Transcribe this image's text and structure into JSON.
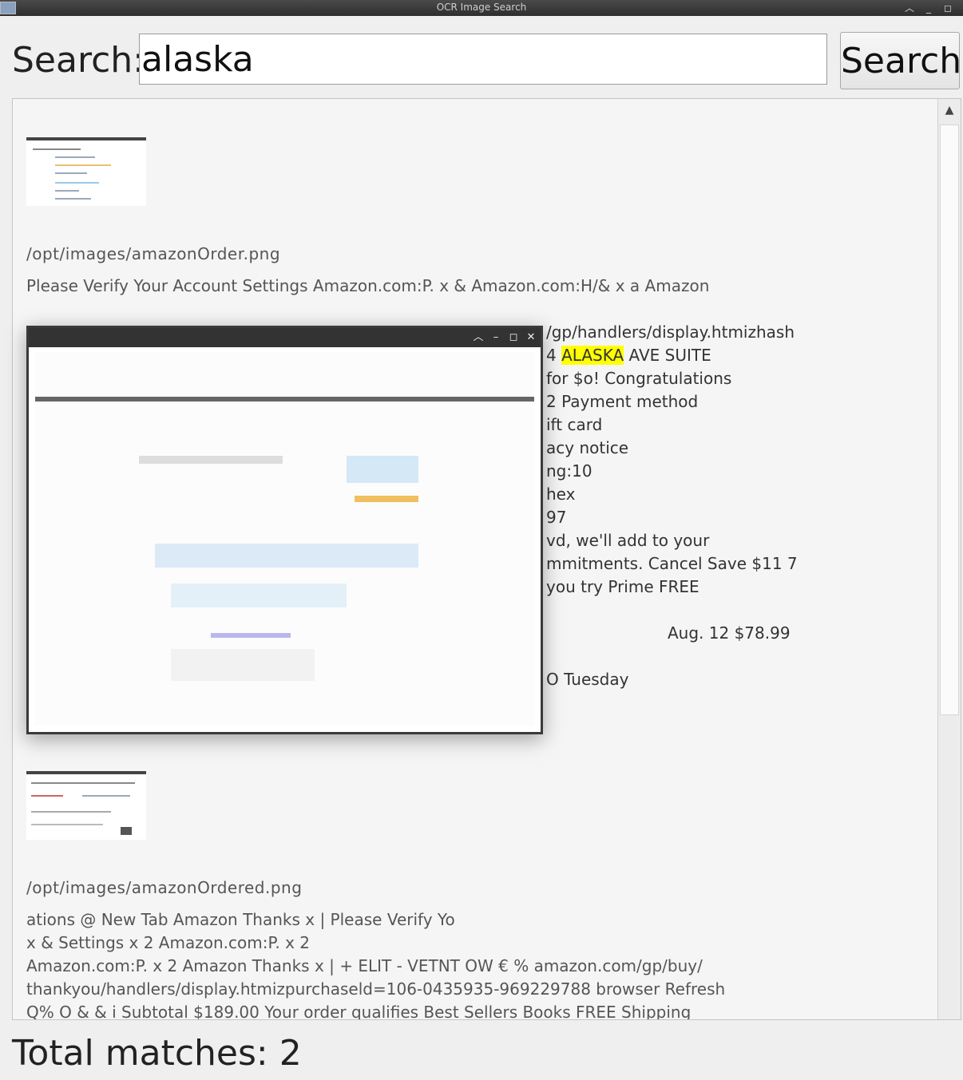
{
  "window": {
    "title": "OCR Image Search"
  },
  "search": {
    "label": "Search:",
    "value": "alaska",
    "button_label": "Search"
  },
  "results": [
    {
      "path": "/opt/images/amazonOrder.png",
      "lines_visible": [
        "Please Verify Your Account Settings",
        "Amazon.com:P. x & Amazon.com:H/& x a Amazon",
        "/gp/handlers/display.htmizhash",
        "4 ALASKA AVE SUITE",
        "for $o! Congratulations",
        "2 Payment method",
        "ift card",
        "acy notice",
        "ng:10",
        "hex",
        "97",
        "vd, we'll add to your",
        "mmitments. Cancel Save $11 7",
        "you try Prime FREE",
        "Aug. 12 $78.99",
        "O Tuesday"
      ],
      "highlight": "ALASKA"
    },
    {
      "path": "/opt/images/amazonOrdered.png",
      "lines_visible": [
        "ations @ New Tab Amazon Thanks x | Please Verify Yo",
        "x & Settings x 2 Amazon.com:P. x 2",
        "Amazon.com:P. x 2 Amazon Thanks x | + ELIT - VETNT OW € % amazon.com/gp/buy/",
        "thankyou/handlers/display.htmizpurchaseld=106-0435935-969229788 browser Refresh",
        "Q% O & & i Subtotal $189.00 Your order qualifies Best Sellers Books FREE Shipping"
      ]
    }
  ],
  "preview_window": {
    "visible": true
  },
  "footer": {
    "total_label": "Total matches: 2"
  }
}
